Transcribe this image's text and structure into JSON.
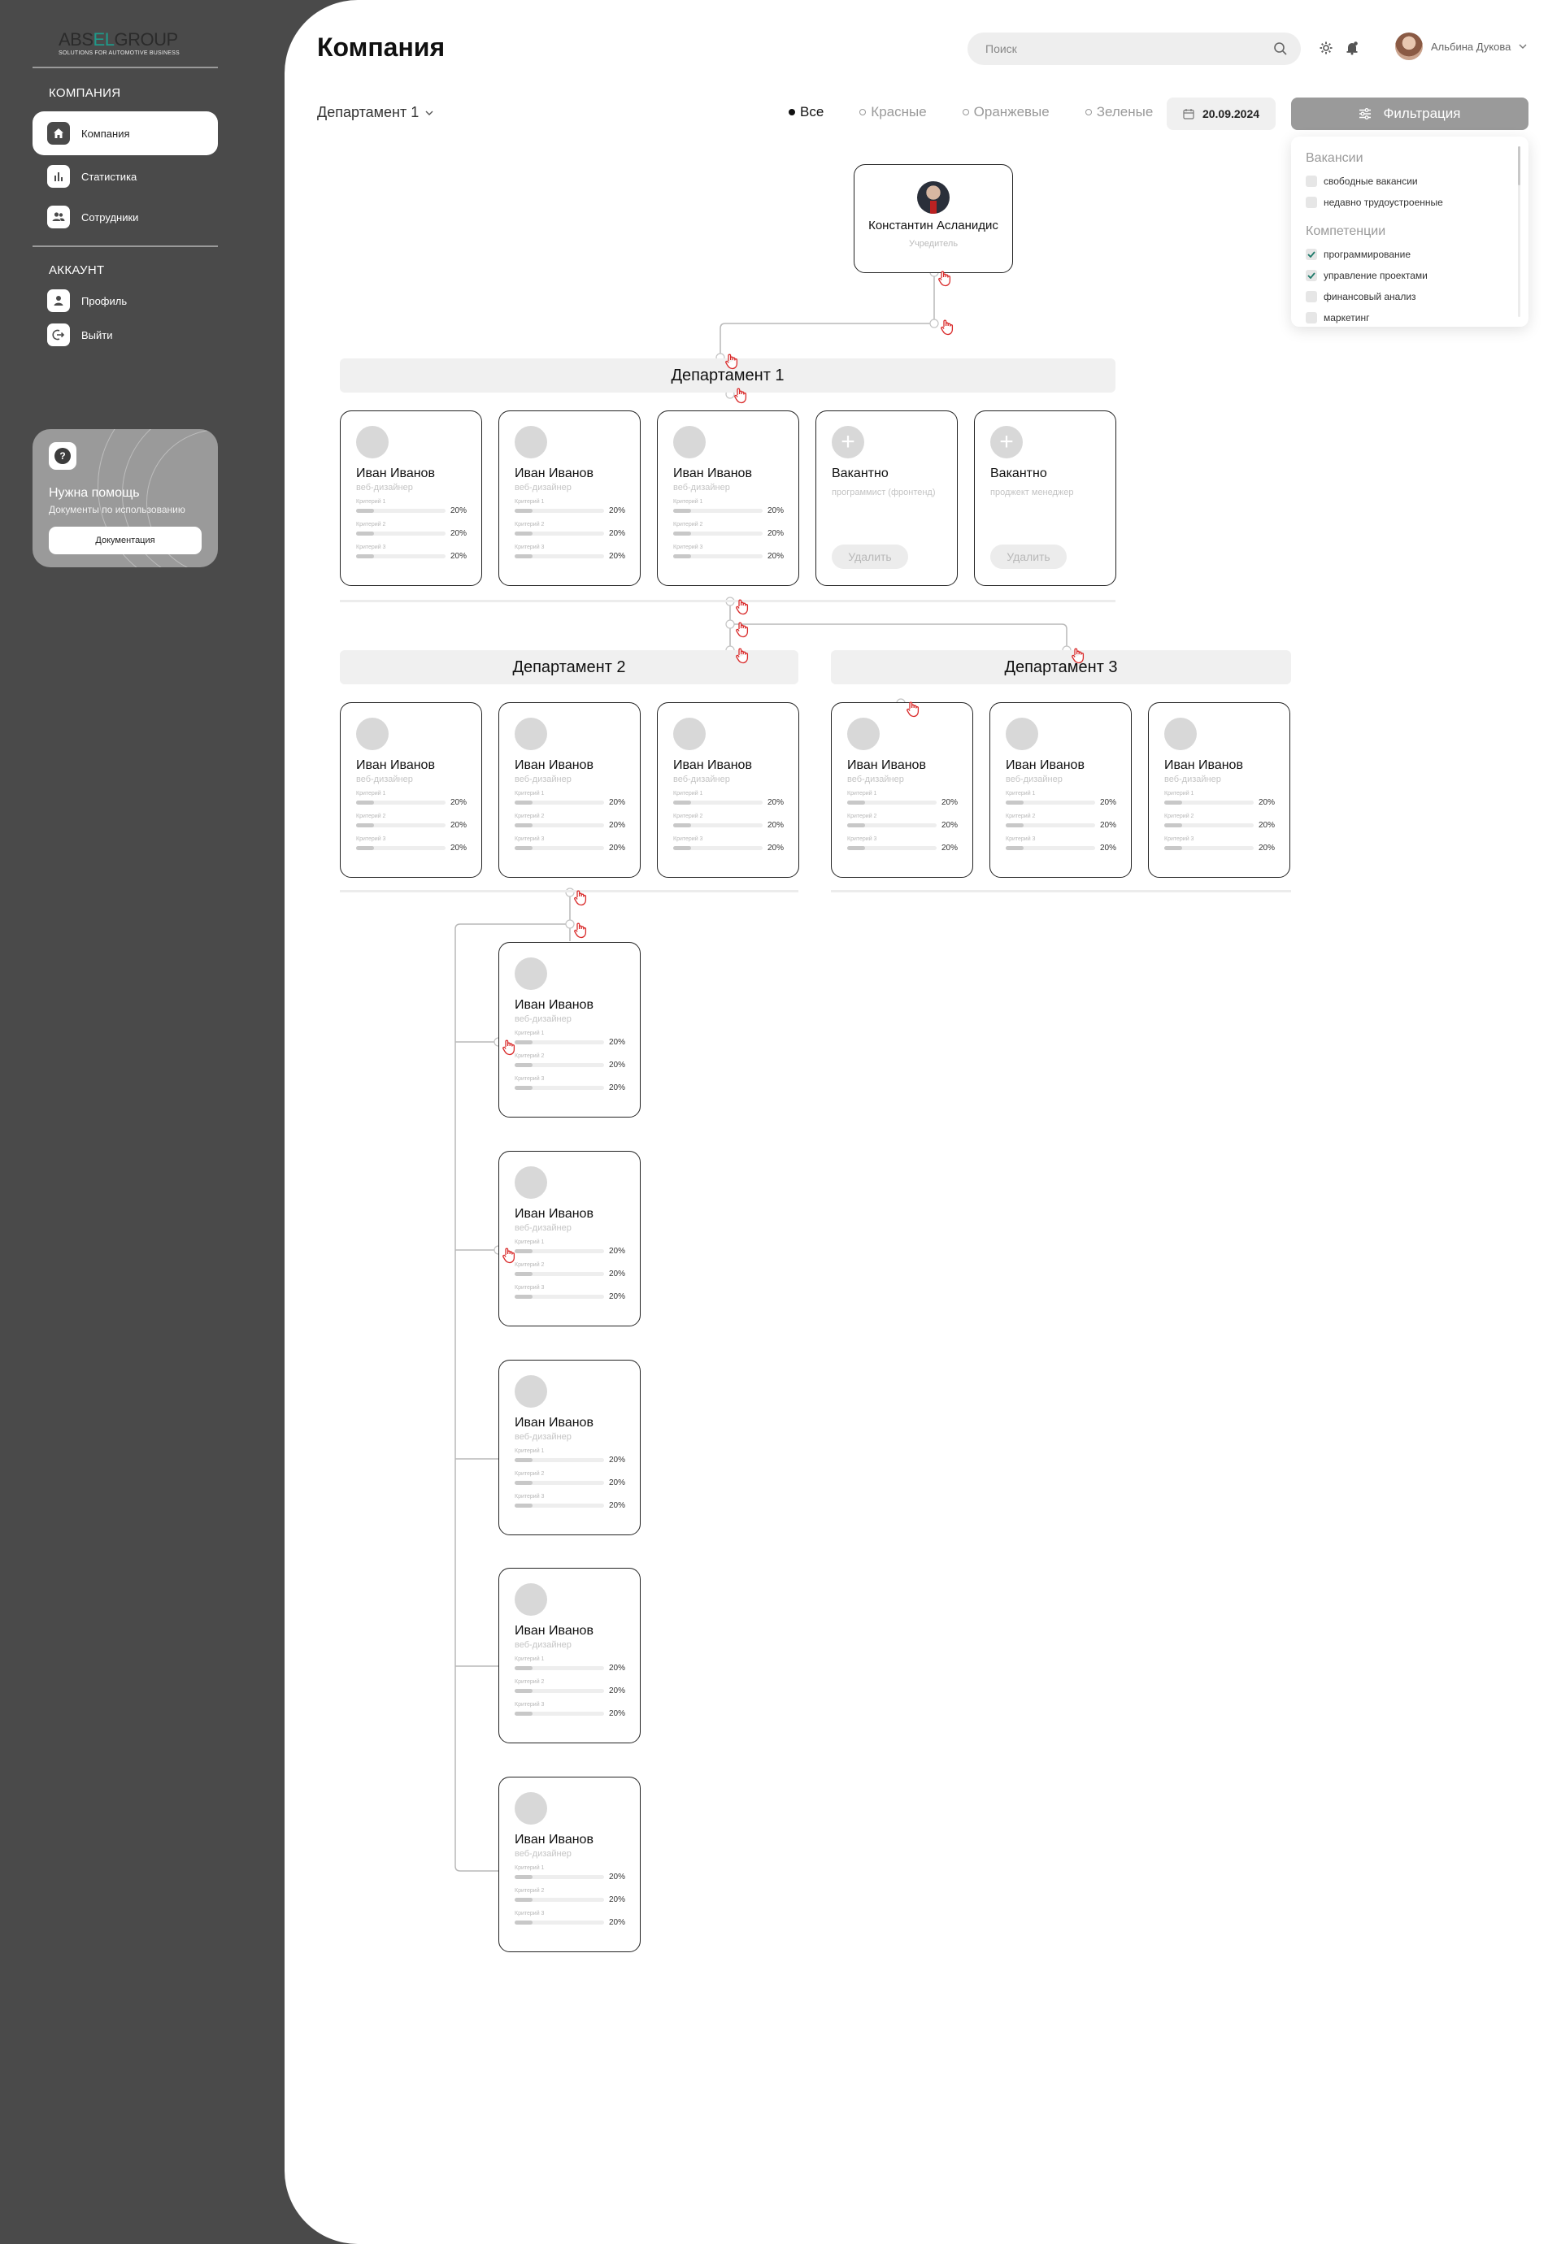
{
  "sidebar": {
    "logo": {
      "part1": "ABS",
      "part2": "EL",
      "part3": "GROUP",
      "tagline": "SOLUTIONS FOR AUTOMOTIVE BUSINESS"
    },
    "company_section": "КОМПАНИЯ",
    "company_items": [
      {
        "label": "Компания",
        "icon": "home-icon",
        "active": true
      },
      {
        "label": "Статистика",
        "icon": "bar-chart-icon",
        "active": false
      },
      {
        "label": "Сотрудники",
        "icon": "users-icon",
        "active": false
      }
    ],
    "account_section": "АККАУНТ",
    "account_items": [
      {
        "label": "Профиль",
        "icon": "user-icon"
      },
      {
        "label": "Выйти",
        "icon": "logout-icon"
      }
    ],
    "help": {
      "title": "Нужна помощь",
      "subtitle": "Документы по использованию",
      "button": "Документация"
    }
  },
  "header": {
    "title": "Компания",
    "search_placeholder": "Поиск",
    "user_name": "Альбина Дукова"
  },
  "toolbar": {
    "department": "Департамент 1",
    "filters": [
      {
        "label": "Все",
        "active": true
      },
      {
        "label": "Красные",
        "active": false
      },
      {
        "label": "Оранжевые",
        "active": false
      },
      {
        "label": "Зеленые",
        "active": false
      }
    ],
    "date": "20.09.2024",
    "filter_button": "Фильтрация"
  },
  "filter_panel": {
    "vacancies_title": "Вакансии",
    "vacancies": [
      {
        "label": "свободные вакансии",
        "checked": false
      },
      {
        "label": "недавно трудоустроенные",
        "checked": false
      }
    ],
    "competencies_title": "Компетенции",
    "competencies": [
      {
        "label": "программирование",
        "checked": true
      },
      {
        "label": "управление проектами",
        "checked": true
      },
      {
        "label": "финансовый анализ",
        "checked": false
      },
      {
        "label": "маркетинг",
        "checked": false
      }
    ]
  },
  "org": {
    "ceo": {
      "name": "Константин Асланидис",
      "role": "Учредитель"
    },
    "departments": [
      "Департамент 1",
      "Департамент 2",
      "Департамент 3"
    ],
    "employee": {
      "name": "Иван Иванов",
      "role": "веб-дизайнер",
      "criteria": [
        {
          "label": "Критерий 1",
          "value": "20%",
          "fill": 0.2
        },
        {
          "label": "Критерий 2",
          "value": "20%",
          "fill": 0.2
        },
        {
          "label": "Критерий 3",
          "value": "20%",
          "fill": 0.2
        }
      ]
    },
    "vacancies": [
      {
        "title": "Вакантно",
        "role": "программист (фронтенд)",
        "delete": "Удалить"
      },
      {
        "title": "Вакантно",
        "role": "проджект менеджер",
        "delete": "Удалить"
      }
    ]
  }
}
